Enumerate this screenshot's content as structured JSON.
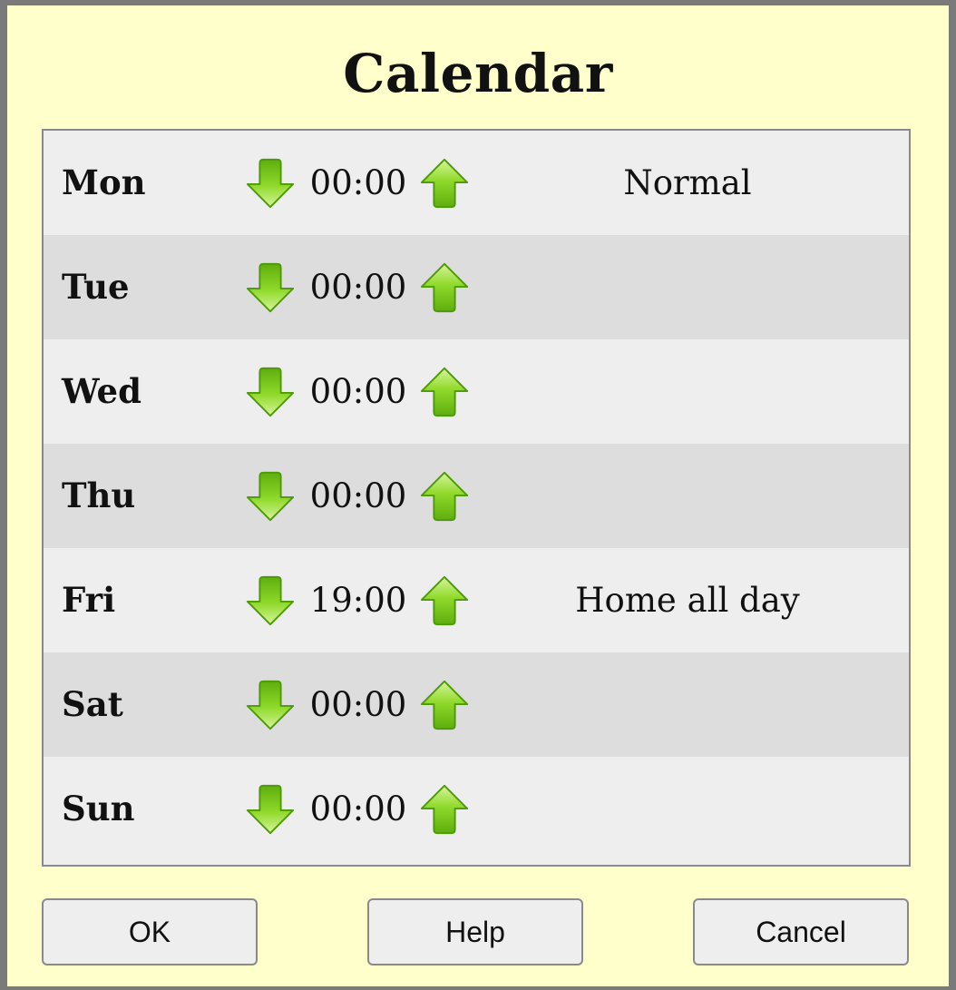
{
  "dialog": {
    "title": "Calendar"
  },
  "schedule": [
    {
      "day": "Mon",
      "time": "00:00",
      "mode": "Normal"
    },
    {
      "day": "Tue",
      "time": "00:00",
      "mode": ""
    },
    {
      "day": "Wed",
      "time": "00:00",
      "mode": ""
    },
    {
      "day": "Thu",
      "time": "00:00",
      "mode": ""
    },
    {
      "day": "Fri",
      "time": "19:00",
      "mode": "Home all day"
    },
    {
      "day": "Sat",
      "time": "00:00",
      "mode": ""
    },
    {
      "day": "Sun",
      "time": "00:00",
      "mode": ""
    }
  ],
  "icons": {
    "decrease": "arrow-down-icon",
    "increase": "arrow-up-icon"
  },
  "buttons": {
    "ok": "OK",
    "help": "Help",
    "cancel": "Cancel"
  },
  "colors": {
    "background": "#ffffcc",
    "row_light": "#eeeeee",
    "row_dark": "#dddddd",
    "arrow_green": "#7ccc1a"
  }
}
